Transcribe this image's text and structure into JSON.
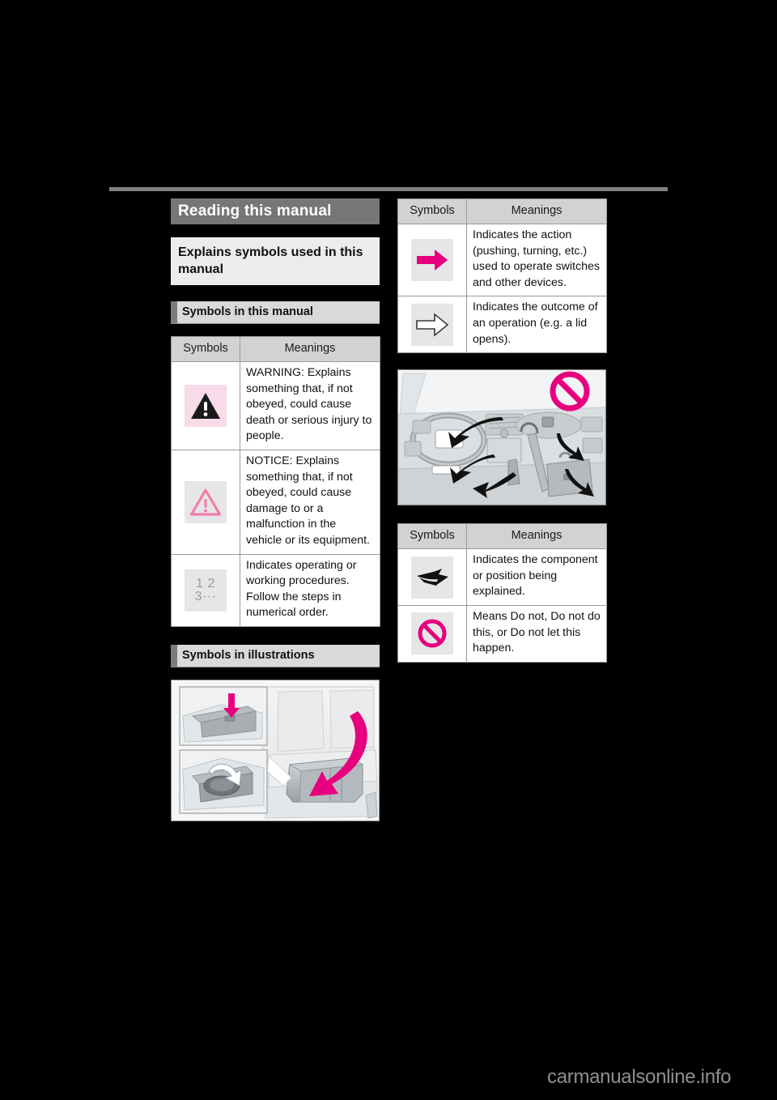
{
  "page": {
    "background_color": "#000000",
    "rule_color": "#808080"
  },
  "chapter": {
    "title": "Reading this manual"
  },
  "section": {
    "title": "Explains symbols used in this manual"
  },
  "subheadings": {
    "symbols_in_manual": "Symbols in this manual",
    "symbols_in_illustrations": "Symbols in illustrations"
  },
  "tables": {
    "headers": {
      "symbols": "Symbols",
      "meanings": "Meanings"
    },
    "manual_symbols": [
      {
        "icon": "warning-triangle-icon",
        "icon_bg": "#f8dbe8",
        "meaning": "WARNING:\nExplains something that, if not obeyed, could cause death or serious injury to people.",
        "meaning_line1": "WARNING:",
        "meaning_line2": "Explains something that, if not obeyed, could cause death or serious injury to people."
      },
      {
        "icon": "notice-triangle-icon",
        "icon_bg": "#e6e6e6",
        "meaning": "NOTICE:\nExplains something that, if not obeyed, could cause damage to or a malfunction in the vehicle or its equipment.",
        "meaning_line1": "NOTICE:",
        "meaning_line2": "Explains something that, if not obeyed, could cause damage to or a malfunction in the vehicle or its equipment."
      },
      {
        "icon": "number-sequence-icon",
        "icon_bg": "#e6e6e6",
        "icon_text": "1 2 3···",
        "meaning": "Indicates operating or working procedures. Follow the steps in numerical order."
      }
    ],
    "illustration_symbols_top": [
      {
        "icon": "solid-arrow-right-icon",
        "icon_color": "#e6007e",
        "icon_bg": "#e6e6e6",
        "meaning": "Indicates the action (pushing, turning, etc.) used to operate switches and other devices."
      },
      {
        "icon": "outline-arrow-right-icon",
        "icon_color": "#ffffff",
        "icon_bg": "#e6e6e6",
        "meaning": "Indicates the outcome of an operation (e.g. a lid opens)."
      }
    ],
    "illustration_symbols_bottom": [
      {
        "icon": "curved-swoosh-arrow-icon",
        "icon_color": "#111111",
        "icon_bg": "#e6e6e6",
        "meaning": "Indicates the component or position being explained."
      },
      {
        "icon": "prohibition-circle-icon",
        "icon_color": "#e6007e",
        "icon_bg": "#e6e6e6",
        "meaning": "Means Do not, Do not do this, or Do not let this happen."
      }
    ]
  },
  "illustrations": {
    "seat_armrest": {
      "name": "rear-seat-armrest-illustration",
      "description": "Rear seat with fold-down center armrest, pink arrows showing push-down and pull-up actions, with two magnified inset panels"
    },
    "dashboard": {
      "name": "dashboard-storage-illustration",
      "description": "Vehicle dashboard interior with black pointer arrows to storage locations and a pink prohibition symbol"
    }
  },
  "colors": {
    "accent_pink": "#e6007e",
    "warning_pink_bg": "#f8dbe8",
    "tile_gray": "#e6e6e6",
    "header_gray": "#d2d2d2",
    "chapter_bar_gray": "#767676"
  },
  "watermark": {
    "text": "carmanualsonline.info"
  }
}
